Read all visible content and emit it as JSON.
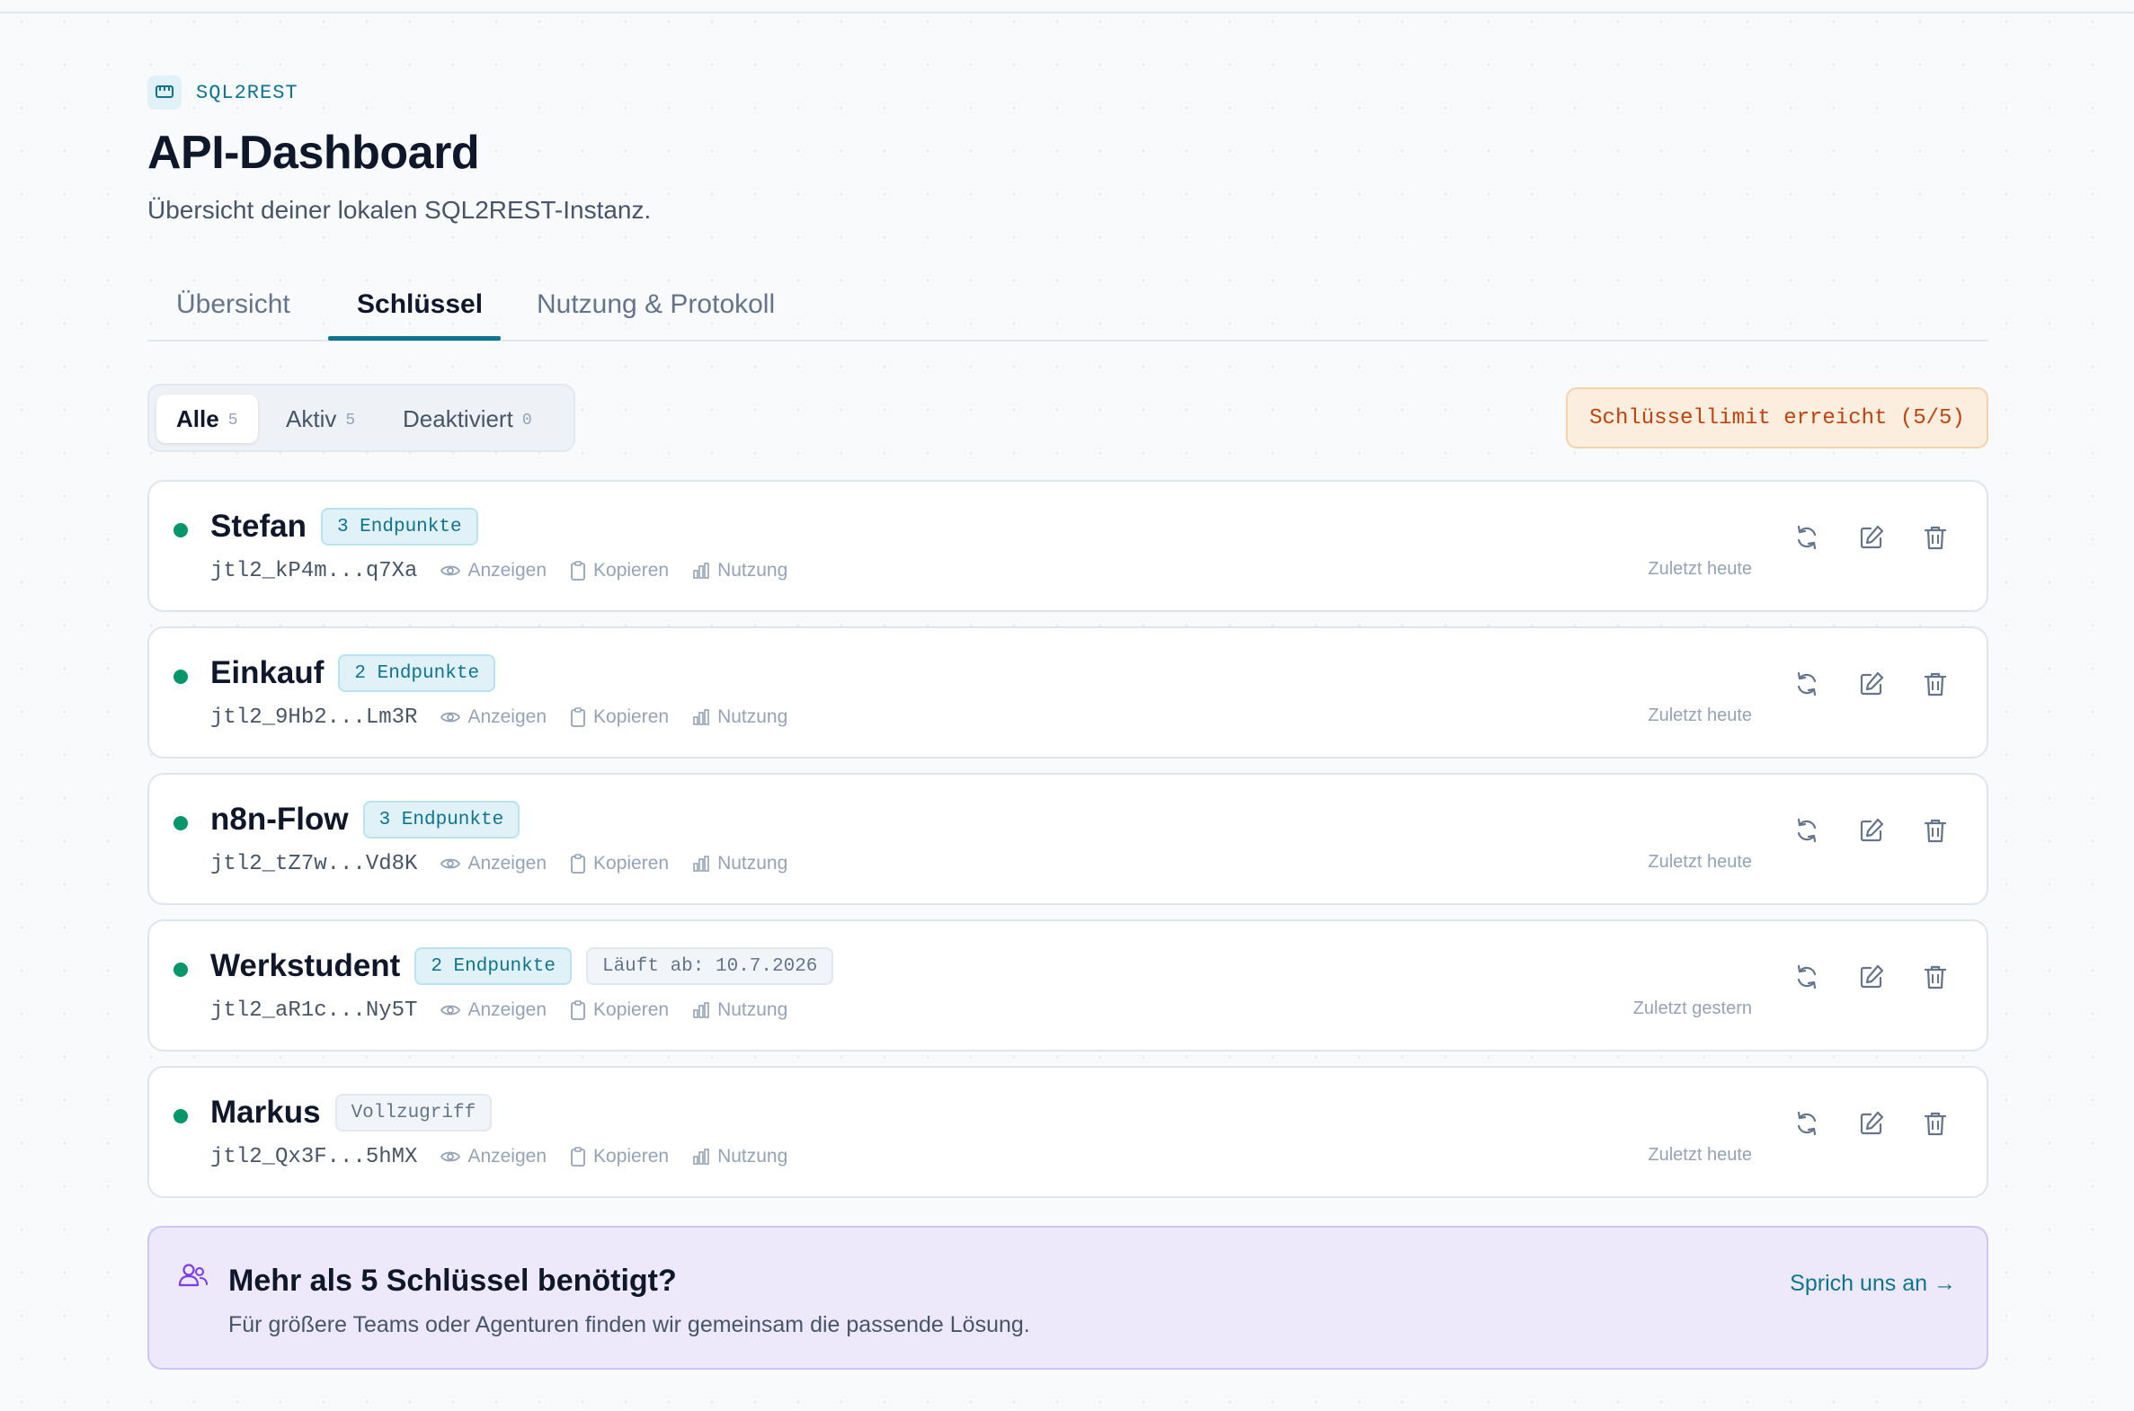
{
  "app": {
    "brand": "SQL2REST",
    "title": "API-Dashboard",
    "subtitle": "Übersicht deiner lokalen SQL2REST-Instanz."
  },
  "tabs": [
    {
      "label": "Übersicht",
      "active": false
    },
    {
      "label": "Schlüssel",
      "active": true
    },
    {
      "label": "Nutzung & Protokoll",
      "active": false
    }
  ],
  "filters": [
    {
      "label": "Alle",
      "count": "5",
      "active": true
    },
    {
      "label": "Aktiv",
      "count": "5",
      "active": false
    },
    {
      "label": "Deaktiviert",
      "count": "0",
      "active": false
    }
  ],
  "limit_badge": "Schlüssellimit erreicht (5/5)",
  "actions": {
    "show": "Anzeigen",
    "copy": "Kopieren",
    "usage": "Nutzung"
  },
  "keys": [
    {
      "name": "Stefan",
      "tag": "3 Endpunkte",
      "extra": "",
      "code": "jtl2_kP4m...q7Xa",
      "last_used": "Zuletzt heute",
      "status": "active"
    },
    {
      "name": "Einkauf",
      "tag": "2 Endpunkte",
      "extra": "",
      "code": "jtl2_9Hb2...Lm3R",
      "last_used": "Zuletzt heute",
      "status": "active"
    },
    {
      "name": "n8n-Flow",
      "tag": "3 Endpunkte",
      "extra": "",
      "code": "jtl2_tZ7w...Vd8K",
      "last_used": "Zuletzt heute",
      "status": "active"
    },
    {
      "name": "Werkstudent",
      "tag": "2 Endpunkte",
      "extra": "Läuft ab: 10.7.2026",
      "code": "jtl2_aR1c...Ny5T",
      "last_used": "Zuletzt gestern",
      "status": "active"
    },
    {
      "name": "Markus",
      "tag": "Vollzugriff",
      "extra": "",
      "code": "jtl2_Qx3F...5hMX",
      "last_used": "Zuletzt heute",
      "status": "active"
    }
  ],
  "cta": {
    "title": "Mehr als 5 Schlüssel benötigt?",
    "text": "Für größere Teams oder Agenturen finden wir gemeinsam die passende Lösung.",
    "link": "Sprich uns an →"
  },
  "colors": {
    "accent": "#0e7490",
    "active_dot": "#059669",
    "warning": "#c2410c",
    "cta_bg": "#ede9fb"
  }
}
